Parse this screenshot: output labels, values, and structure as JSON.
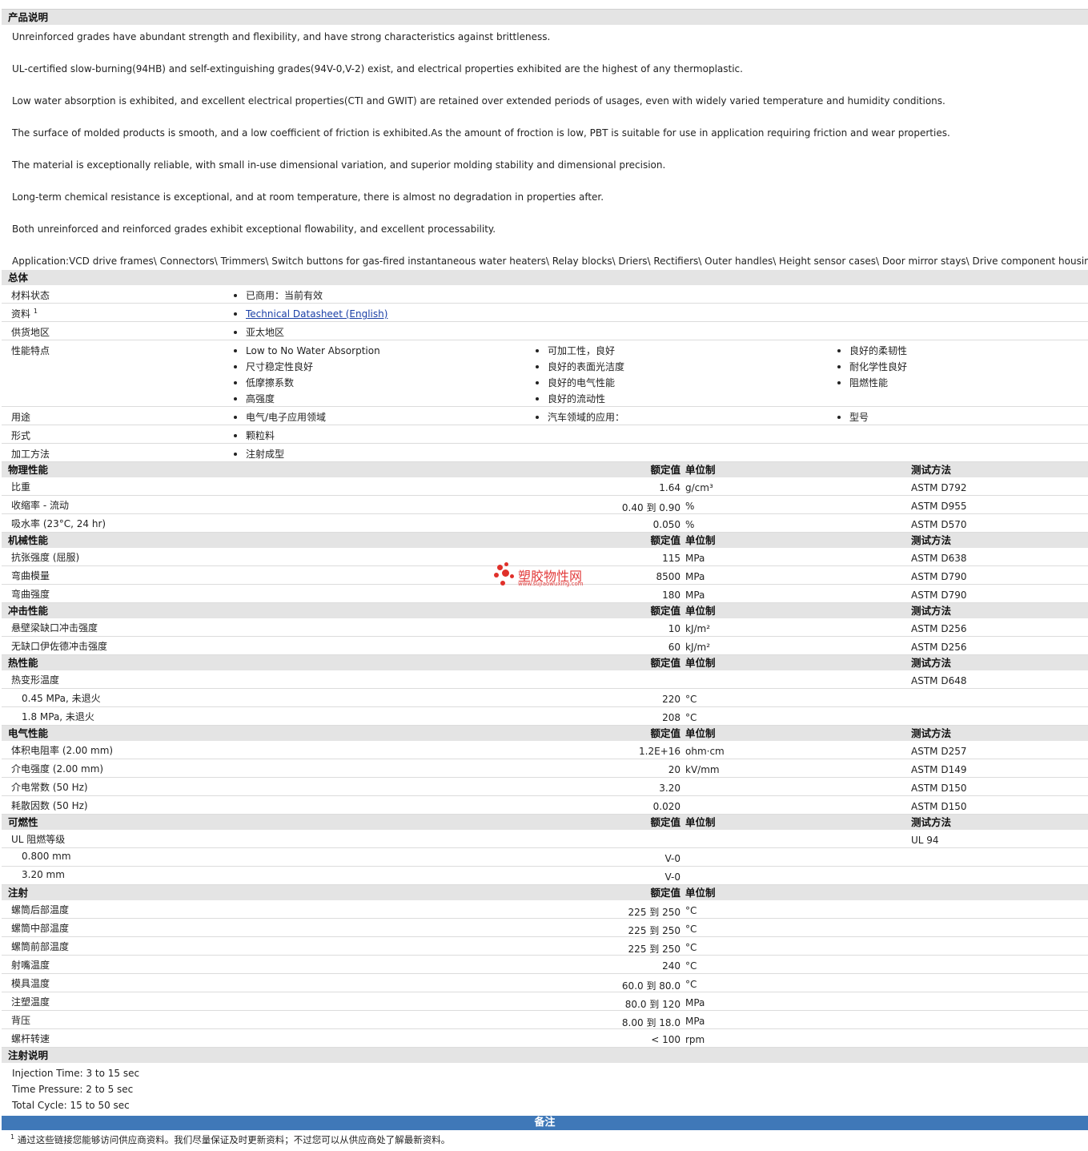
{
  "description": {
    "title": "产品说明",
    "lines": [
      "Unreinforced grades have abundant strength and flexibility, and have strong characteristics against brittleness.",
      "UL-certified slow-burning(94HB) and self-extinguishing grades(94V-0,V-2) exist, and electrical properties exhibited are the highest of any thermoplastic.",
      "Low water absorption is exhibited, and excellent electrical properties(CTI and GWIT) are retained over extended periods of usages, even with widely varied temperature and humidity conditions.",
      "The surface of molded products is smooth, and a low coefficient of friction is exhibited.As the amount of froction is low, PBT is suitable for use in application requiring friction and wear properties.",
      "The material is exceptionally reliable, with small in-use dimensional variation, and superior molding stability and dimensional precision.",
      "Long-term chemical resistance is exceptional, and at room temperature, there is almost no degradation in properties after.",
      "Both unreinforced and reinforced grades exhibit exceptional flowability, and excellent processability.",
      "Application:VCD drive frames\\ Connectors\\ Trimmers\\ Switch buttons for gas-fired instantaneous water heaters\\ Relay blocks\\ Driers\\ Rectifiers\\ Outer handles\\ Height sensor cases\\ Door mirror stays\\ Drive component housings\\ Energy saving lamps"
    ]
  },
  "general": {
    "title": "总体",
    "rows": [
      {
        "label": "材料状态",
        "cols": [
          [
            "已商用：当前有效"
          ],
          [],
          []
        ]
      },
      {
        "label": "资料",
        "sup": "1",
        "link": "Technical Datasheet (English)"
      },
      {
        "label": "供货地区",
        "cols": [
          [
            "亚太地区"
          ],
          [],
          []
        ]
      },
      {
        "label": "性能特点",
        "cols": [
          [
            "Low to No Water Absorption",
            "尺寸稳定性良好",
            "低摩擦系数",
            "高强度"
          ],
          [
            "可加工性，良好",
            "良好的表面光洁度",
            "良好的电气性能",
            "良好的流动性"
          ],
          [
            "良好的柔韧性",
            "耐化学性良好",
            "阻燃性能"
          ]
        ]
      },
      {
        "label": "用途",
        "cols": [
          [
            "电气/电子应用领域"
          ],
          [
            "汽车领域的应用："
          ],
          [
            "型号"
          ]
        ]
      },
      {
        "label": "形式",
        "cols": [
          [
            "颗粒料"
          ],
          [],
          []
        ]
      },
      {
        "label": "加工方法",
        "cols": [
          [
            "注射成型"
          ],
          [],
          []
        ]
      }
    ]
  },
  "headers": {
    "value": "额定值",
    "unit": "单位制",
    "test": "测试方法"
  },
  "sections": [
    {
      "title": "物理性能",
      "test": true,
      "rows": [
        {
          "label": "比重",
          "value": "1.64",
          "unit": "g/cm³",
          "test": "ASTM D792"
        },
        {
          "label": "收缩率  - 流动",
          "value": "0.40 到  0.90",
          "unit": "%",
          "test": "ASTM D955"
        },
        {
          "label": "吸水率  (23°C, 24 hr)",
          "value": "0.050",
          "unit": "%",
          "test": "ASTM D570"
        }
      ]
    },
    {
      "title": "机械性能",
      "test": true,
      "rows": [
        {
          "label": "抗张强度  (屈服)",
          "value": "115",
          "unit": "MPa",
          "test": "ASTM D638"
        },
        {
          "label": "弯曲模量",
          "value": "8500",
          "unit": "MPa",
          "test": "ASTM D790"
        },
        {
          "label": "弯曲强度",
          "value": "180",
          "unit": "MPa",
          "test": "ASTM D790"
        }
      ]
    },
    {
      "title": "冲击性能",
      "test": true,
      "rows": [
        {
          "label": "悬壁梁缺口冲击强度",
          "value": "10",
          "unit": "kJ/m²",
          "test": "ASTM D256"
        },
        {
          "label": "无缺口伊佐德冲击强度",
          "value": "60",
          "unit": "kJ/m²",
          "test": "ASTM D256"
        }
      ]
    },
    {
      "title": "热性能",
      "test": true,
      "rows": [
        {
          "label": "热变形温度",
          "value": "",
          "unit": "",
          "test": "ASTM D648"
        },
        {
          "label": "0.45 MPa, 未退火",
          "sub": true,
          "value": "220",
          "unit": "°C",
          "test": ""
        },
        {
          "label": "1.8 MPa, 未退火",
          "sub": true,
          "value": "208",
          "unit": "°C",
          "test": ""
        }
      ]
    },
    {
      "title": "电气性能",
      "test": true,
      "rows": [
        {
          "label": "体积电阻率  (2.00 mm)",
          "value": "1.2E+16",
          "unit": "ohm·cm",
          "test": "ASTM D257"
        },
        {
          "label": "介电强度  (2.00 mm)",
          "value": "20",
          "unit": "kV/mm",
          "test": "ASTM D149"
        },
        {
          "label": "介电常数  (50 Hz)",
          "value": "3.20",
          "unit": "",
          "test": "ASTM D150"
        },
        {
          "label": "耗散因数  (50 Hz)",
          "value": "0.020",
          "unit": "",
          "test": "ASTM D150"
        }
      ]
    },
    {
      "title": "可燃性",
      "test": true,
      "rows": [
        {
          "label": "UL 阻燃等级",
          "value": "",
          "unit": "",
          "test": "UL 94"
        },
        {
          "label": "0.800 mm",
          "sub": true,
          "value": "V-0",
          "unit": "",
          "test": ""
        },
        {
          "label": "3.20 mm",
          "sub": true,
          "value": "V-0",
          "unit": "",
          "test": ""
        }
      ]
    },
    {
      "title": "注射",
      "test": false,
      "rows": [
        {
          "label": "螺筒后部温度",
          "value": "225 到  250",
          "unit": "°C",
          "test": ""
        },
        {
          "label": "螺筒中部温度",
          "value": "225 到  250",
          "unit": "°C",
          "test": ""
        },
        {
          "label": "螺筒前部温度",
          "value": "225 到  250",
          "unit": "°C",
          "test": ""
        },
        {
          "label": "射嘴温度",
          "value": "240",
          "unit": "°C",
          "test": ""
        },
        {
          "label": "模具温度",
          "value": "60.0 到  80.0",
          "unit": "°C",
          "test": ""
        },
        {
          "label": "注塑温度",
          "value": "80.0 到  120",
          "unit": "MPa",
          "test": ""
        },
        {
          "label": "背压",
          "value": "8.00 到  18.0",
          "unit": "MPa",
          "test": ""
        },
        {
          "label": "螺杆转速",
          "value": "< 100",
          "unit": "rpm",
          "test": ""
        }
      ]
    }
  ],
  "injection_notes": {
    "title": "注射说明",
    "lines": [
      "Injection Time: 3 to 15 sec",
      "Time Pressure: 2 to 5 sec",
      "Total Cycle: 15 to 50 sec"
    ]
  },
  "remarks": {
    "title": "备注",
    "sup": "1",
    "footnote": "通过这些链接您能够访问供应商资料。我们尽量保证及时更新资料；不过您可以从供应商处了解最新资料。"
  },
  "watermark": {
    "brand": "塑胶物性网",
    "url": "www.sujiaowuxing.com",
    "color": "#e23b3b"
  }
}
